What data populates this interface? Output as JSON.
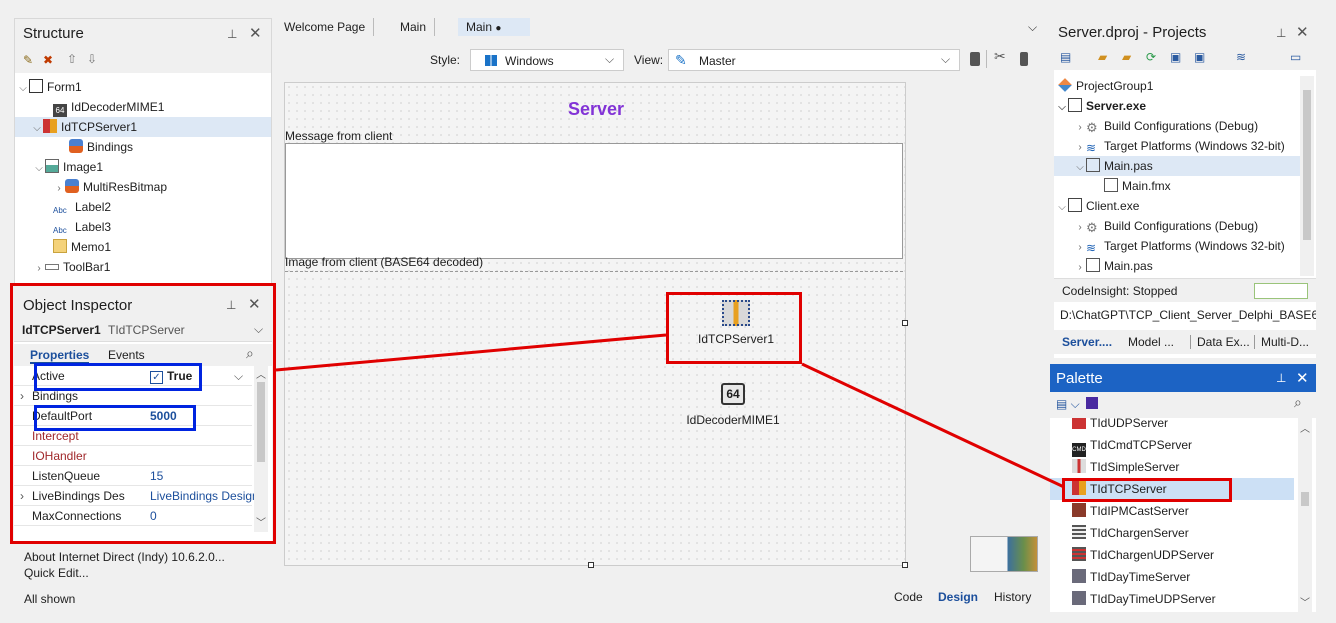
{
  "structure": {
    "title": "Structure",
    "items": [
      {
        "label": "Form1"
      },
      {
        "label": "IdDecoderMIME1"
      },
      {
        "label": "IdTCPServer1"
      },
      {
        "label": "Bindings"
      },
      {
        "label": "Image1"
      },
      {
        "label": "MultiResBitmap"
      },
      {
        "label": "Label2"
      },
      {
        "label": "Label3"
      },
      {
        "label": "Memo1"
      },
      {
        "label": "ToolBar1"
      }
    ]
  },
  "inspector": {
    "title": "Object Inspector",
    "object_name": "IdTCPServer1",
    "object_type": "TIdTCPServer",
    "tab_properties": "Properties",
    "tab_events": "Events",
    "properties": [
      {
        "name": "Active",
        "value": "True"
      },
      {
        "name": "Bindings",
        "value": ""
      },
      {
        "name": "DefaultPort",
        "value": "5000"
      },
      {
        "name": "Intercept",
        "value": ""
      },
      {
        "name": "IOHandler",
        "value": ""
      },
      {
        "name": "ListenQueue",
        "value": "15"
      },
      {
        "name": "LiveBindings Des",
        "value": "LiveBindings Design"
      },
      {
        "name": "MaxConnections",
        "value": "0"
      }
    ],
    "footer_link1": "About Internet Direct (Indy) 10.6.2.0...",
    "footer_link2": "Quick Edit...",
    "status": "All shown"
  },
  "editor": {
    "tabs": [
      "Welcome Page",
      "Main",
      "Main"
    ],
    "style_label": "Style:",
    "style_value": "Windows",
    "view_label": "View:",
    "view_value": "Master",
    "form_title": "Server",
    "label_message": "Message from client",
    "label_image": "Image from client (BASE64 decoded)",
    "comp_server": "IdTCPServer1",
    "comp_decoder": "IdDecoderMIME1",
    "comp_decoder_badge": "64",
    "bottom_tabs": [
      "Code",
      "Design",
      "History"
    ]
  },
  "projects": {
    "title": "Server.dproj - Projects",
    "items": [
      {
        "label": "ProjectGroup1"
      },
      {
        "label": "Server.exe"
      },
      {
        "label": "Build Configurations (Debug)"
      },
      {
        "label": "Target Platforms (Windows 32-bit)"
      },
      {
        "label": "Main.pas"
      },
      {
        "label": "Main.fmx"
      },
      {
        "label": "Client.exe"
      },
      {
        "label": "Build Configurations (Debug)"
      },
      {
        "label": "Target Platforms (Windows 32-bit)"
      },
      {
        "label": "Main.pas"
      }
    ],
    "codeinsight": "CodeInsight: Stopped",
    "path": "D:\\ChatGPT\\TCP_Client_Server_Delphi_BASE6...",
    "tabs": [
      "Server....",
      "Model ...",
      "Data Ex...",
      "Multi-D..."
    ]
  },
  "palette": {
    "title": "Palette",
    "items": [
      {
        "label": "TIdUDPServer"
      },
      {
        "label": "TIdCmdTCPServer"
      },
      {
        "label": "TIdSimpleServer"
      },
      {
        "label": "TIdTCPServer"
      },
      {
        "label": "TIdIPMCastServer"
      },
      {
        "label": "TIdChargenServer"
      },
      {
        "label": "TIdChargenUDPServer"
      },
      {
        "label": "TIdDayTimeServer"
      },
      {
        "label": "TIdDayTimeUDPServer"
      }
    ]
  },
  "colors": {
    "annotation_red": "#e00000",
    "annotation_blue": "#0024e0",
    "accent": "#1c4f9c"
  }
}
